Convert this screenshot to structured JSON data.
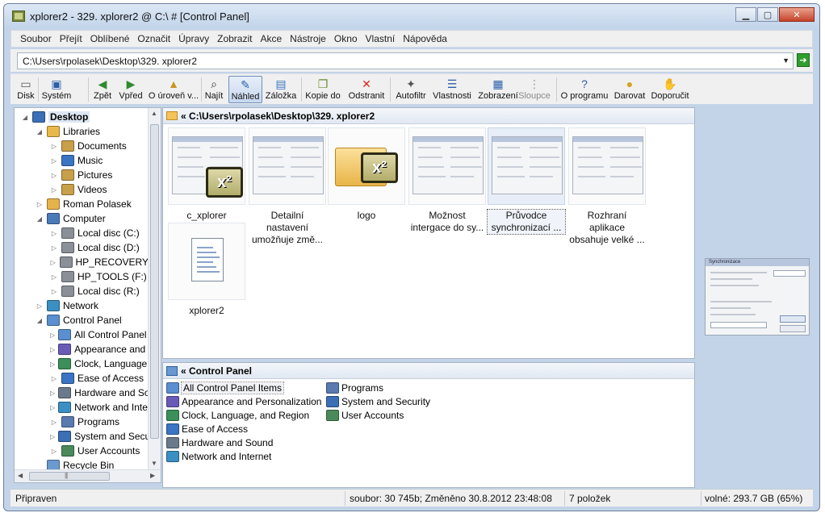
{
  "window": {
    "title": "xplorer2 - 329. xplorer2 @ C:\\ # [Control Panel]",
    "buttons": {
      "minimize": "▁",
      "maximize": "▢",
      "close": "✕"
    }
  },
  "menu": [
    "Soubor",
    "Přejít",
    "Oblíbené",
    "Označit",
    "Úpravy",
    "Zobrazit",
    "Akce",
    "Nástroje",
    "Okno",
    "Vlastní",
    "Nápověda"
  ],
  "address": {
    "value": "C:\\Users\\rpolasek\\Desktop\\329. xplorer2",
    "dropdown": "▼",
    "go": "➔"
  },
  "toolbar": [
    {
      "label": "Disk",
      "icon": "drive-icon",
      "glyph": "▭",
      "color": "#555"
    },
    {
      "label": "Systém",
      "icon": "monitor-icon",
      "glyph": "▣",
      "color": "#2a5ea8"
    },
    {
      "label": "Zpět",
      "icon": "back-icon",
      "glyph": "◀",
      "color": "#2e8b2e"
    },
    {
      "label": "Vpřed",
      "icon": "forward-icon",
      "glyph": "▶",
      "color": "#2e8b2e"
    },
    {
      "label": "O úroveň v...",
      "icon": "up-folder-icon",
      "glyph": "▲",
      "color": "#c8961e"
    },
    {
      "label": "Najít",
      "icon": "binoculars-icon",
      "glyph": "⌕",
      "color": "#333"
    },
    {
      "label": "Náhled",
      "icon": "preview-icon",
      "glyph": "✎",
      "color": "#2a5ea8"
    },
    {
      "label": "Záložka",
      "icon": "tab-icon",
      "glyph": "▤",
      "color": "#3b74c2"
    },
    {
      "label": "Kopie do",
      "icon": "copy-icon",
      "glyph": "❐",
      "color": "#6a8a2a"
    },
    {
      "label": "Odstranit",
      "icon": "delete-icon",
      "glyph": "✕",
      "color": "#d22"
    },
    {
      "label": "Autofiltr",
      "icon": "wand-icon",
      "glyph": "✦",
      "color": "#555"
    },
    {
      "label": "Vlastnosti",
      "icon": "properties-icon",
      "glyph": "☰",
      "color": "#2a5ea8"
    },
    {
      "label": "Zobrazení",
      "icon": "grid-icon",
      "glyph": "▦",
      "color": "#2a5ea8"
    },
    {
      "label": "Sloupce",
      "icon": "columns-icon",
      "glyph": "⋮",
      "color": "#999"
    },
    {
      "label": "O programu",
      "icon": "help-icon",
      "glyph": "?",
      "color": "#2a5ea8"
    },
    {
      "label": "Darovat",
      "icon": "coins-icon",
      "glyph": "●",
      "color": "#d4a21e"
    },
    {
      "label": "Doporučit",
      "icon": "thumb-icon",
      "glyph": "✋",
      "color": "#d98a3a"
    }
  ],
  "tree": [
    {
      "label": "Desktop",
      "level": 0,
      "toggle": "◢",
      "icon": "desktop-icon",
      "color": "#3b6fb6",
      "root": true
    },
    {
      "label": "Libraries",
      "level": 1,
      "toggle": "◢",
      "icon": "library-icon",
      "color": "#e8b84a"
    },
    {
      "label": "Documents",
      "level": 2,
      "toggle": "▷",
      "icon": "documents-icon",
      "color": "#c9a04a"
    },
    {
      "label": "Music",
      "level": 2,
      "toggle": "▷",
      "icon": "music-icon",
      "color": "#3b74c2"
    },
    {
      "label": "Pictures",
      "level": 2,
      "toggle": "▷",
      "icon": "pictures-icon",
      "color": "#c9a04a"
    },
    {
      "label": "Videos",
      "level": 2,
      "toggle": "▷",
      "icon": "videos-icon",
      "color": "#c9a04a"
    },
    {
      "label": "Roman Polasek",
      "level": 1,
      "toggle": "▷",
      "icon": "user-folder-icon",
      "color": "#e6b24a"
    },
    {
      "label": "Computer",
      "level": 1,
      "toggle": "◢",
      "icon": "computer-icon",
      "color": "#4a7ab8"
    },
    {
      "label": "Local disc (C:)",
      "level": 2,
      "toggle": "▷",
      "icon": "drive-c-icon",
      "color": "#8a8f98"
    },
    {
      "label": "Local disc (D:)",
      "level": 2,
      "toggle": "▷",
      "icon": "drive-icon",
      "color": "#8a8f98"
    },
    {
      "label": "HP_RECOVERY",
      "level": 2,
      "toggle": "▷",
      "icon": "drive-icon",
      "color": "#8a8f98"
    },
    {
      "label": "HP_TOOLS (F:)",
      "level": 2,
      "toggle": "▷",
      "icon": "drive-icon",
      "color": "#8a8f98"
    },
    {
      "label": "Local disc (R:)",
      "level": 2,
      "toggle": "▷",
      "icon": "drive-icon",
      "color": "#8a8f98"
    },
    {
      "label": "Network",
      "level": 1,
      "toggle": "▷",
      "icon": "network-icon",
      "color": "#3b8fc2"
    },
    {
      "label": "Control Panel",
      "level": 1,
      "toggle": "◢",
      "icon": "control-panel-icon",
      "color": "#5a8fd0"
    },
    {
      "label": "All Control Panel Items",
      "level": 2,
      "toggle": "▷",
      "icon": "control-panel-icon",
      "color": "#5a8fd0"
    },
    {
      "label": "Appearance and Personalization",
      "level": 2,
      "toggle": "▷",
      "icon": "appearance-icon",
      "color": "#6a5ab8"
    },
    {
      "label": "Clock, Language, and Region",
      "level": 2,
      "toggle": "▷",
      "icon": "clock-icon",
      "color": "#3b8f5a"
    },
    {
      "label": "Ease of Access",
      "level": 2,
      "toggle": "▷",
      "icon": "ease-of-access-icon",
      "color": "#3b74c2"
    },
    {
      "label": "Hardware and Sound",
      "level": 2,
      "toggle": "▷",
      "icon": "hardware-icon",
      "color": "#6a7a8a"
    },
    {
      "label": "Network and Internet",
      "level": 2,
      "toggle": "▷",
      "icon": "network-icon",
      "color": "#3b8fc2"
    },
    {
      "label": "Programs",
      "level": 2,
      "toggle": "▷",
      "icon": "programs-icon",
      "color": "#5a7ab0"
    },
    {
      "label": "System and Security",
      "level": 2,
      "toggle": "▷",
      "icon": "security-icon",
      "color": "#3b6fb6"
    },
    {
      "label": "User Accounts",
      "level": 2,
      "toggle": "▷",
      "icon": "users-icon",
      "color": "#4a8a5a"
    },
    {
      "label": "Recycle Bin",
      "level": 1,
      "toggle": "",
      "icon": "recycle-bin-icon",
      "color": "#6a9ad0"
    }
  ],
  "top_pane": {
    "path": "« C:\\Users\\rpolasek\\Desktop\\329. xplorer2",
    "items": [
      {
        "label": "c_xplorer",
        "kind": "shot-x2"
      },
      {
        "label": "Detailní nastavení umožňuje změ...",
        "kind": "shot"
      },
      {
        "label": "logo",
        "kind": "folder-x2"
      },
      {
        "label": "Možnost intergace do sy...",
        "kind": "shot"
      },
      {
        "label": "Průvodce synchronizací ...",
        "kind": "shot",
        "selected": true
      },
      {
        "label": "Rozhraní aplikace obsahuje velké ...",
        "kind": "shot"
      },
      {
        "label": "xplorer2",
        "kind": "doc"
      }
    ],
    "x2_mark": "x²"
  },
  "bottom_pane": {
    "path": "« Control Panel",
    "items": [
      {
        "label": "All Control Panel Items",
        "icon": "control-panel-icon",
        "color": "#5a8fd0",
        "selected": true
      },
      {
        "label": "Appearance and Personalization",
        "icon": "appearance-icon",
        "color": "#6a5ab8"
      },
      {
        "label": "Clock, Language, and Region",
        "icon": "clock-icon",
        "color": "#3b8f5a"
      },
      {
        "label": "Ease of Access",
        "icon": "ease-of-access-icon",
        "color": "#3b74c2"
      },
      {
        "label": "Hardware and Sound",
        "icon": "hardware-icon",
        "color": "#6a7a8a"
      },
      {
        "label": "Network and Internet",
        "icon": "network-icon",
        "color": "#3b8fc2"
      },
      {
        "label": "Programs",
        "icon": "programs-icon",
        "color": "#5a7ab0"
      },
      {
        "label": "System and Security",
        "icon": "security-icon",
        "color": "#3b6fb6"
      },
      {
        "label": "User Accounts",
        "icon": "users-icon",
        "color": "#4a8a5a"
      }
    ]
  },
  "preview": {
    "shot_label": "Synchronizace"
  },
  "status": {
    "ready": "Připraven",
    "file": "soubor: 30 745b; Změněno 30.8.2012 23:48:08",
    "count": "7 položek",
    "free": "volné: 293.7 GB (65%)"
  }
}
